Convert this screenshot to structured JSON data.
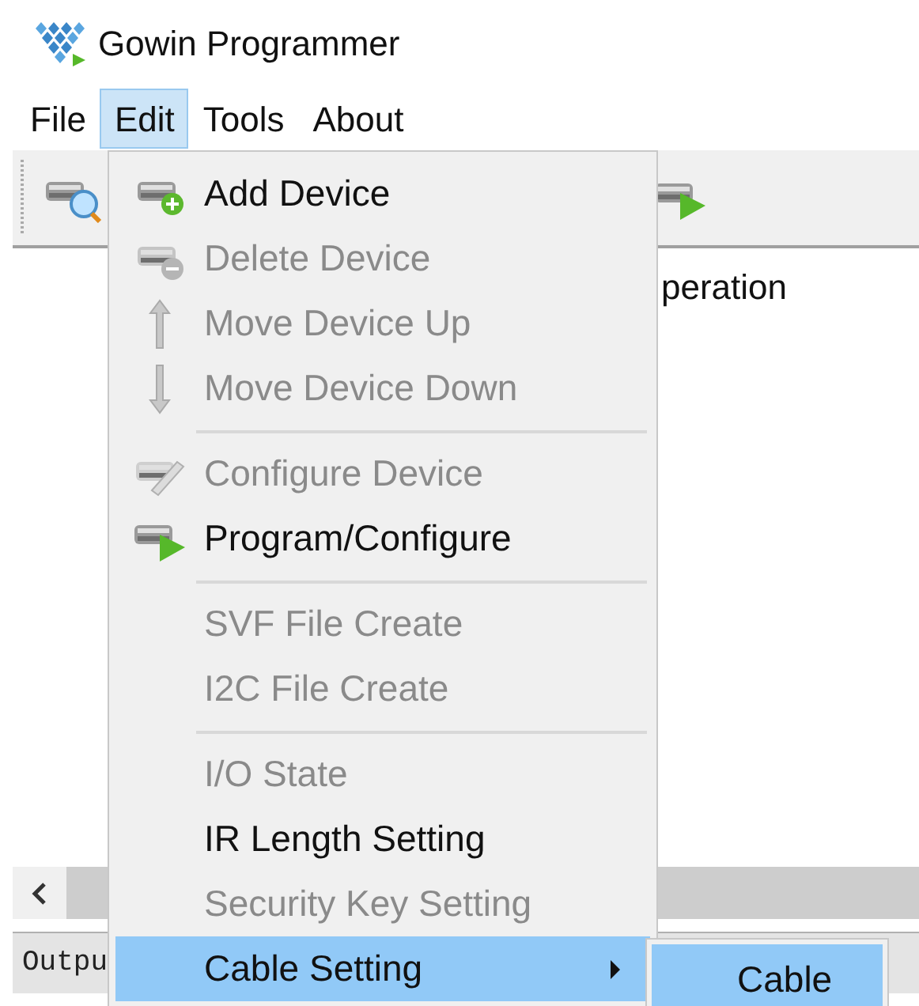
{
  "window": {
    "title": "Gowin Programmer"
  },
  "menu_bar": [
    {
      "label": "File",
      "selected": false
    },
    {
      "label": "Edit",
      "selected": true
    },
    {
      "label": "Tools",
      "selected": false
    },
    {
      "label": "About",
      "selected": false
    }
  ],
  "content": {
    "column_heading": "peration"
  },
  "output_tab": {
    "label": "Outpu"
  },
  "edit_menu": [
    {
      "kind": "item",
      "label": "Add Device",
      "disabled": false,
      "selected": false
    },
    {
      "kind": "item",
      "label": "Delete Device",
      "disabled": true,
      "selected": false
    },
    {
      "kind": "item",
      "label": "Move Device Up",
      "disabled": true,
      "selected": false
    },
    {
      "kind": "item",
      "label": "Move Device Down",
      "disabled": true,
      "selected": false
    },
    {
      "kind": "separator"
    },
    {
      "kind": "item",
      "label": "Configure Device",
      "disabled": true,
      "selected": false
    },
    {
      "kind": "item",
      "label": "Program/Configure",
      "disabled": false,
      "selected": false
    },
    {
      "kind": "separator"
    },
    {
      "kind": "item",
      "label": "SVF File Create",
      "disabled": true,
      "selected": false
    },
    {
      "kind": "item",
      "label": "I2C File Create",
      "disabled": true,
      "selected": false
    },
    {
      "kind": "separator"
    },
    {
      "kind": "item",
      "label": "I/O State",
      "disabled": true,
      "selected": false
    },
    {
      "kind": "item",
      "label": "IR Length Setting",
      "disabled": false,
      "selected": false
    },
    {
      "kind": "item",
      "label": "Security Key Setting",
      "disabled": true,
      "selected": false
    },
    {
      "kind": "submenu",
      "label": "Cable Setting",
      "disabled": false,
      "selected": true
    }
  ],
  "cable_submenu": [
    {
      "label": "Cable",
      "selected": true
    }
  ]
}
